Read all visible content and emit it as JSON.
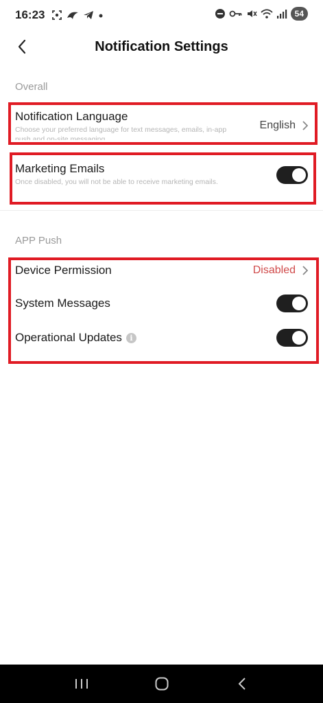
{
  "status_bar": {
    "time": "16:23",
    "battery": "54",
    "icons": [
      "screenshot-icon",
      "bird-icon",
      "telegram-icon",
      "dot-icon",
      "do-not-disturb-icon",
      "key-icon",
      "mute-icon",
      "wifi-icon",
      "signal-icon"
    ]
  },
  "header": {
    "title": "Notification Settings",
    "back_icon": "chevron-left-icon"
  },
  "overall": {
    "label": "Overall",
    "notification_language": {
      "title": "Notification Language",
      "description": "Choose your preferred language for text messages, emails, in-app push and on-site messaging",
      "value": "English"
    },
    "marketing_emails": {
      "title": "Marketing Emails",
      "description": "Once disabled, you will not be able to receive marketing emails.",
      "enabled": true
    }
  },
  "app_push": {
    "label": "APP Push",
    "device_permission": {
      "title": "Device Permission",
      "value": "Disabled"
    },
    "system_messages": {
      "title": "System Messages",
      "enabled": true
    },
    "operational_updates": {
      "title": "Operational Updates",
      "info_icon": "i",
      "enabled": true
    }
  },
  "colors": {
    "highlight": "#e01b24",
    "toggle_on": "#1f1f1f",
    "danger_text": "#d04a4a"
  },
  "nav_bar": {
    "icons": [
      "recent-apps-icon",
      "home-icon",
      "back-icon"
    ]
  }
}
